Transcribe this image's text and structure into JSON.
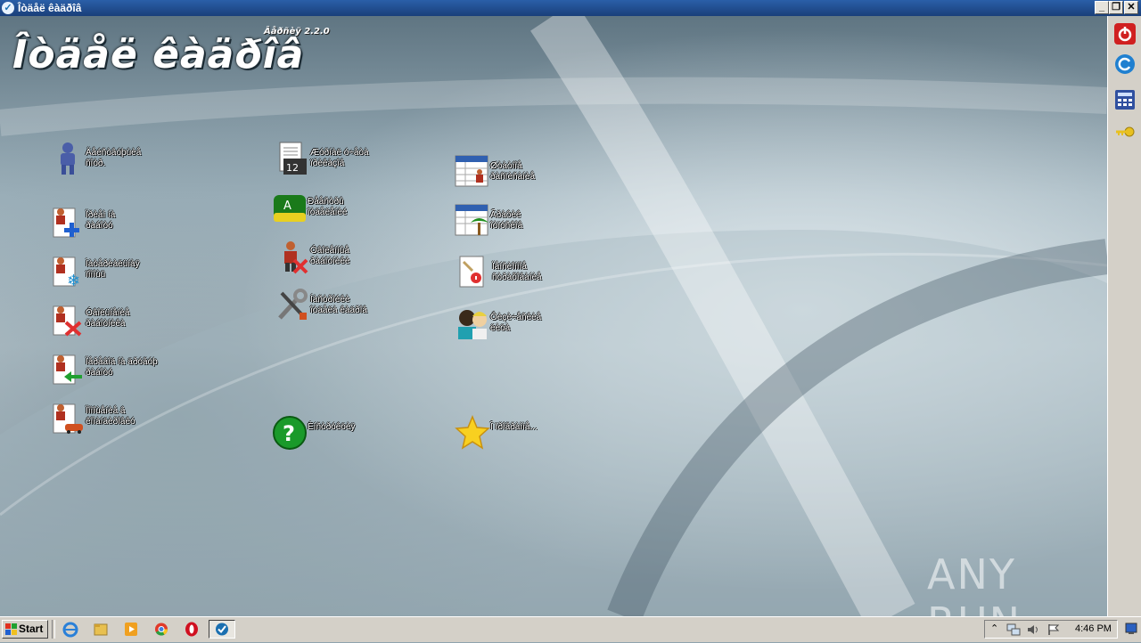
{
  "window": {
    "title": "Îòäåë êàäðîâ",
    "buttons": [
      "minimize",
      "restore",
      "close"
    ]
  },
  "header": {
    "app_title": "Îòäåë êàäðîâ",
    "version": "Âåðñèÿ 2.2.0"
  },
  "menu": {
    "col1": [
      {
        "icon": "employees-icon",
        "label": "Äåéñòâóþùèå\nñîòð."
      },
      {
        "icon": "add-employee-icon",
        "label": "Ïðèåì íà\nðàáîòó"
      },
      {
        "icon": "vacation-icon",
        "label": "Ìàòåðèàëüíàÿ\nïîìîùü"
      },
      {
        "icon": "dismiss-employee-icon",
        "label": "Óâîëüíåíèå\nðàáîòíèêà"
      },
      {
        "icon": "transfer-employee-icon",
        "label": "Ïåðåâîä íà äðóãóþ\nðàáîòó"
      },
      {
        "icon": "trip-employee-icon",
        "label": "Ïîìîùåíèå â\nêîìàíäèðîâêó"
      }
    ],
    "col2": [
      {
        "icon": "documents-icon",
        "label": "Æóðíàë ó÷åòà\nïðèêàçîâ"
      },
      {
        "icon": "reports-icon",
        "label": "Ðååñòðû\nîòäåëåíèé"
      },
      {
        "icon": "fired-list-icon",
        "label": "Óâîëåííûå\nðàáîòíèêè"
      },
      {
        "icon": "tools-icon",
        "label": "Íàñòðîéêè\nîòäåëà êàäðîâ"
      },
      {
        "icon": "help-icon",
        "label": "Èíñòðóêöèÿ"
      }
    ],
    "col3": [
      {
        "icon": "staff-table-icon",
        "label": "Øòàòíîå\nðàñïèñàíèå"
      },
      {
        "icon": "vacation-schedule-icon",
        "label": "Ãðàôèê\nîòïóñêîâ"
      },
      {
        "icon": "certificate-icon",
        "label": "Ïåíñèîííîå\nñòðàõîâàíèå"
      },
      {
        "icon": "people-icon",
        "label": "Ôèçè÷åñêèå\nëèöà"
      },
      {
        "icon": "star-icon",
        "label": "Î ïðîãðàììå..."
      }
    ]
  },
  "watermark": "ANY RUN",
  "right_toolbar": [
    "power-icon",
    "refresh-icon",
    "calculator-icon",
    "key-icon"
  ],
  "taskbar": {
    "start_label": "Start",
    "apps": [
      "ie-icon",
      "explorer-icon",
      "media-player-icon",
      "chrome-icon",
      "opera-icon",
      "hr-app-icon"
    ],
    "clock": "4:46 PM"
  },
  "colors": {
    "titlebar": "#1a3f7a",
    "taskbar": "#d4d0c8",
    "label_text": "#ffffff"
  }
}
